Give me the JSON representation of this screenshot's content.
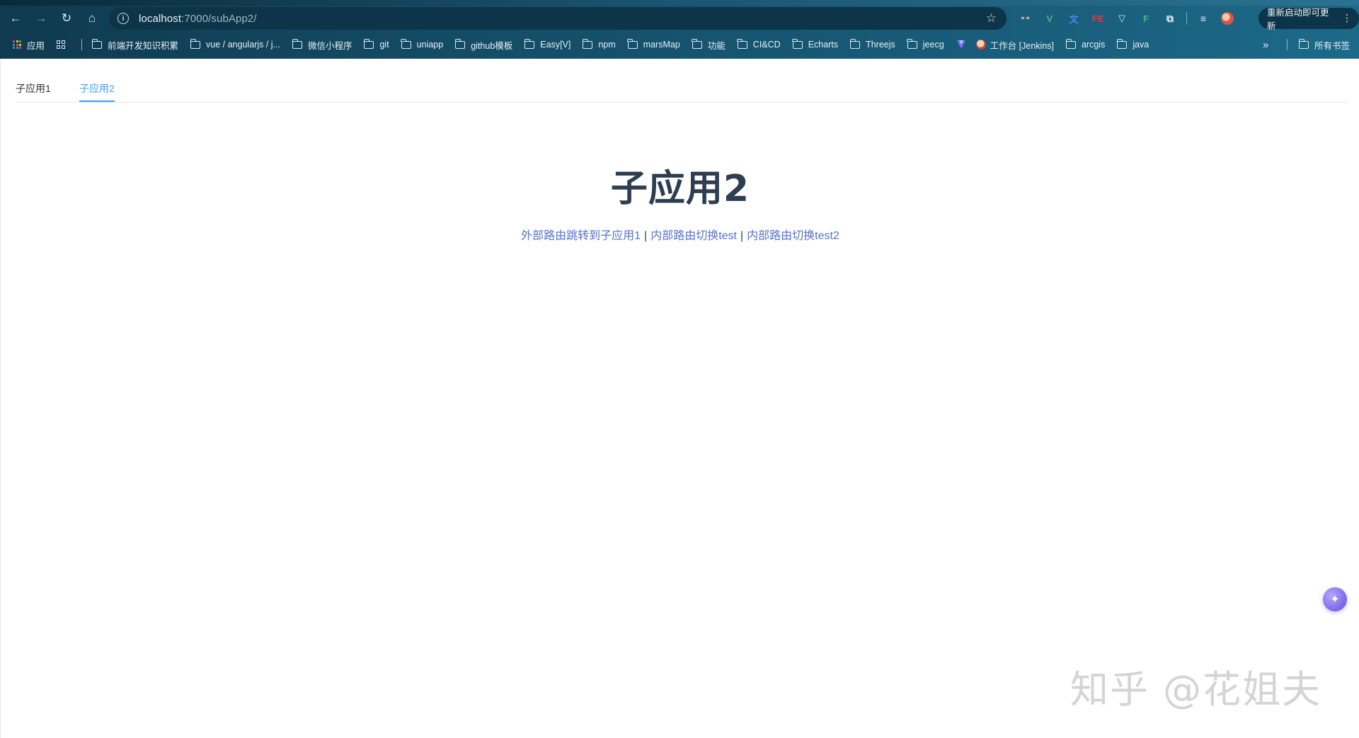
{
  "browser": {
    "url_host": "localhost",
    "url_path": ":7000/subApp2/",
    "update_label": "重新启动即可更新",
    "extensions": [
      {
        "name": "eye-extension",
        "glyph": "👓",
        "color": "#ffffff"
      },
      {
        "name": "vue-devtools",
        "glyph": "V",
        "color": "#42b883"
      },
      {
        "name": "translate-extension",
        "glyph": "文",
        "color": "#4a8af4"
      },
      {
        "name": "fe-helper",
        "glyph": "FE",
        "color": "#e53935"
      },
      {
        "name": "vite-extension",
        "glyph": "▽",
        "color": "#cfe0e8"
      },
      {
        "name": "f-extension",
        "glyph": "F",
        "color": "#42b883"
      }
    ]
  },
  "bookmarks": {
    "apps_label": "应用",
    "items": [
      "前端开发知识积累",
      "vue / angularjs / j...",
      "微信小程序",
      "git",
      "uniapp",
      "github模板",
      "Easy[V]",
      "npm",
      "marsMap",
      "功能",
      "CI&CD",
      "Echarts",
      "Threejs",
      "jeecg"
    ],
    "jenkins_label": "工作台 [Jenkins]",
    "more_items": [
      "arcgis",
      "java"
    ],
    "all_bookmarks_label": "所有书签"
  },
  "tabs": [
    {
      "label": "子应用1",
      "active": false
    },
    {
      "label": "子应用2",
      "active": true
    }
  ],
  "heading": "子应用2",
  "links": {
    "external": "外部路由跳转到子应用1",
    "separator": "|",
    "internal_test": "内部路由切换test",
    "internal_test2": "内部路由切换test2"
  },
  "watermark": "知乎 @花姐夫",
  "colors": {
    "accent": "#409eff",
    "link": "#5672cd",
    "heading": "#2c3e50"
  }
}
